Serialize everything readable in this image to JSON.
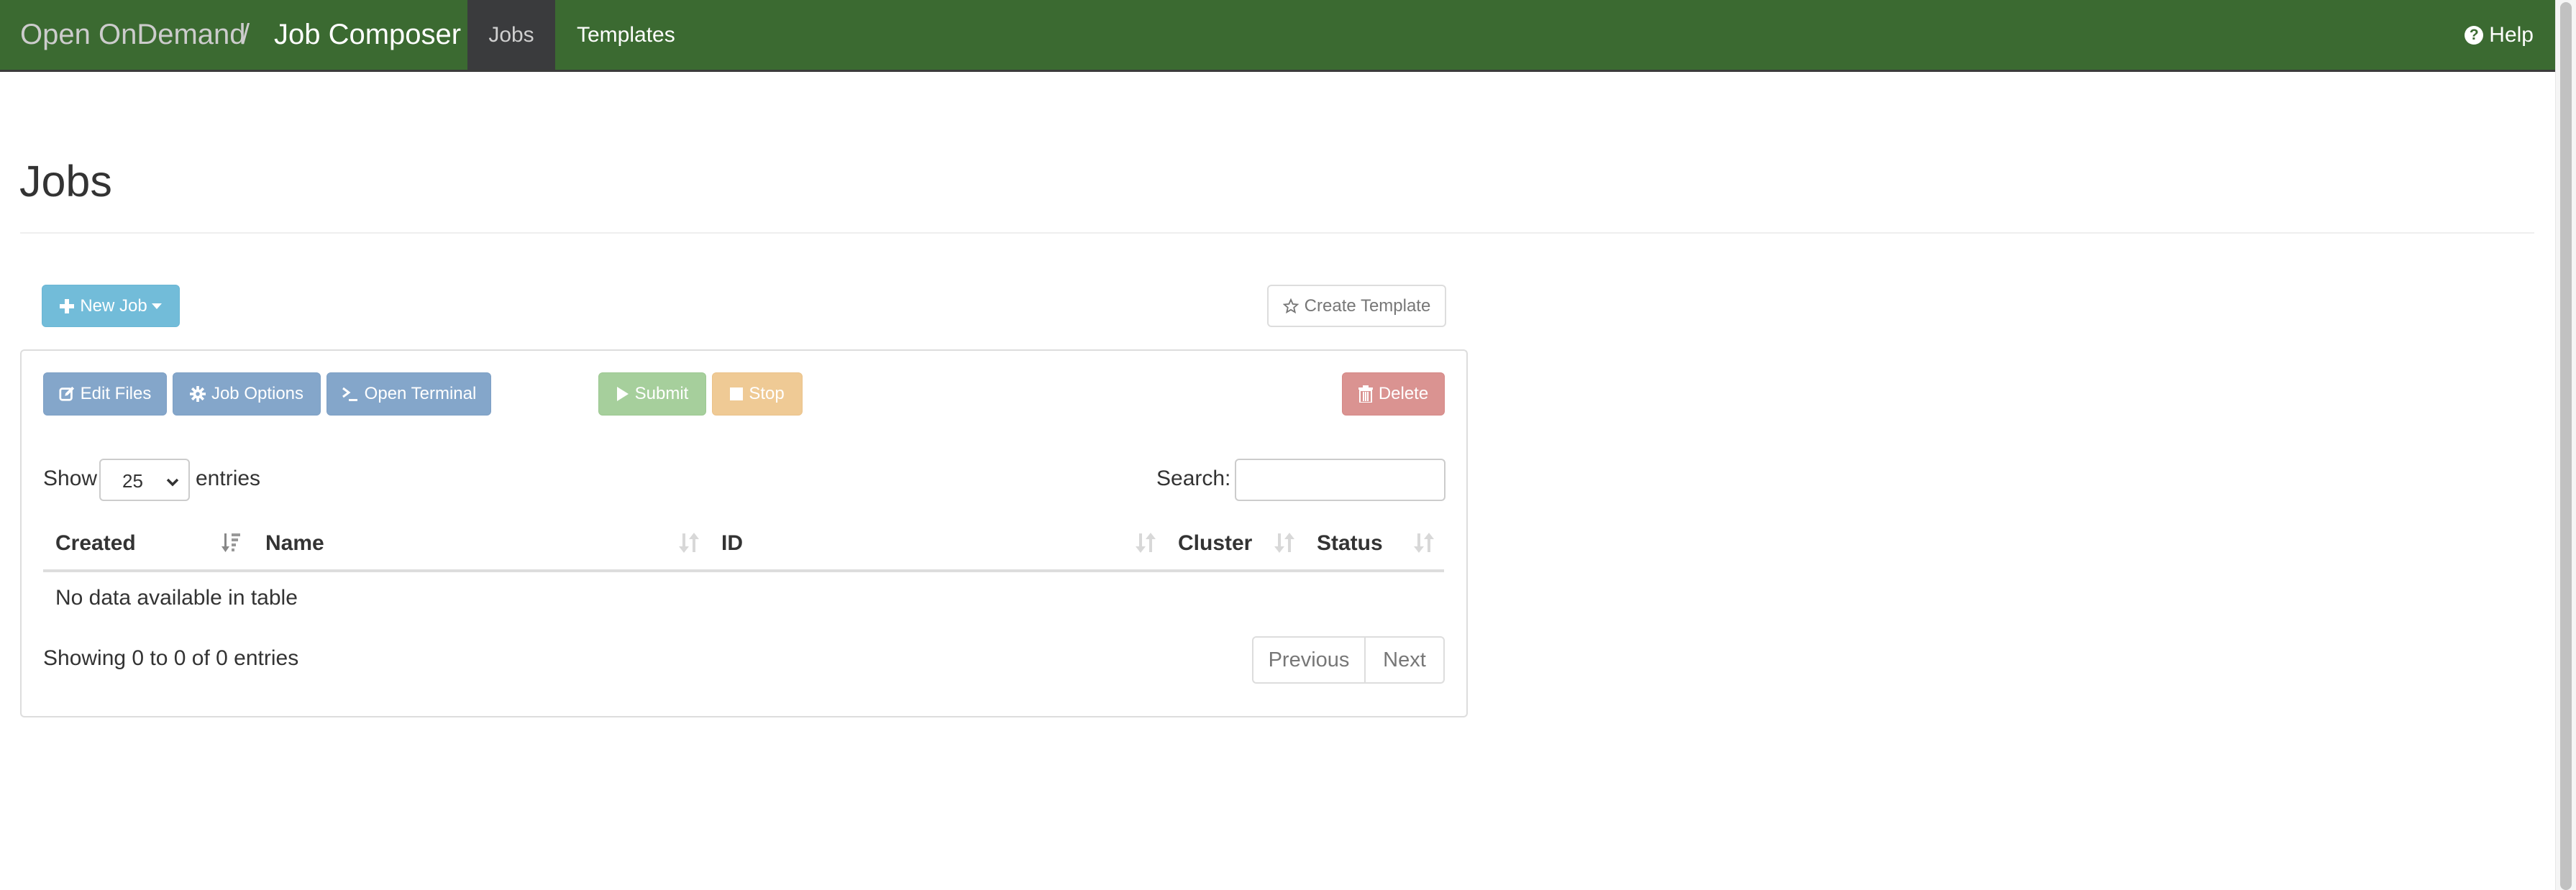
{
  "navbar": {
    "brand": "Open OnDemand",
    "separator": "/",
    "app_title": "Job Composer",
    "tabs": [
      {
        "label": "Jobs",
        "active": true
      },
      {
        "label": "Templates",
        "active": false
      }
    ],
    "help": {
      "label": "Help",
      "icon": "question-circle-icon"
    },
    "colors": {
      "background": "#3b6a31",
      "active_tab": "#3a3b3d"
    }
  },
  "page": {
    "title": "Jobs"
  },
  "actions": {
    "new_job": {
      "label": "New Job",
      "icon": "plus-icon",
      "has_dropdown": true
    },
    "create_template": {
      "label": "Create Template",
      "icon": "star-outline-icon"
    }
  },
  "toolbar": {
    "edit_files": {
      "label": "Edit Files",
      "icon": "edit-icon"
    },
    "job_options": {
      "label": "Job Options",
      "icon": "gear-icon"
    },
    "open_terminal": {
      "label": "Open Terminal",
      "icon": "terminal-icon"
    },
    "submit": {
      "label": "Submit",
      "icon": "play-icon"
    },
    "stop": {
      "label": "Stop",
      "icon": "stop-icon"
    },
    "delete": {
      "label": "Delete",
      "icon": "trash-icon"
    }
  },
  "table_controls": {
    "length": {
      "prefix": "Show",
      "selected": "25",
      "suffix": "entries"
    },
    "search": {
      "label": "Search:",
      "value": "",
      "placeholder": ""
    }
  },
  "table": {
    "columns": [
      {
        "label": "Created",
        "sort": "descending"
      },
      {
        "label": "Name",
        "sort": "none"
      },
      {
        "label": "ID",
        "sort": "none"
      },
      {
        "label": "Cluster",
        "sort": "none"
      },
      {
        "label": "Status",
        "sort": "none"
      }
    ],
    "rows": [],
    "empty_message": "No data available in table",
    "info": "Showing 0 to 0 of 0 entries",
    "pagination": {
      "previous": "Previous",
      "next": "Next"
    }
  }
}
